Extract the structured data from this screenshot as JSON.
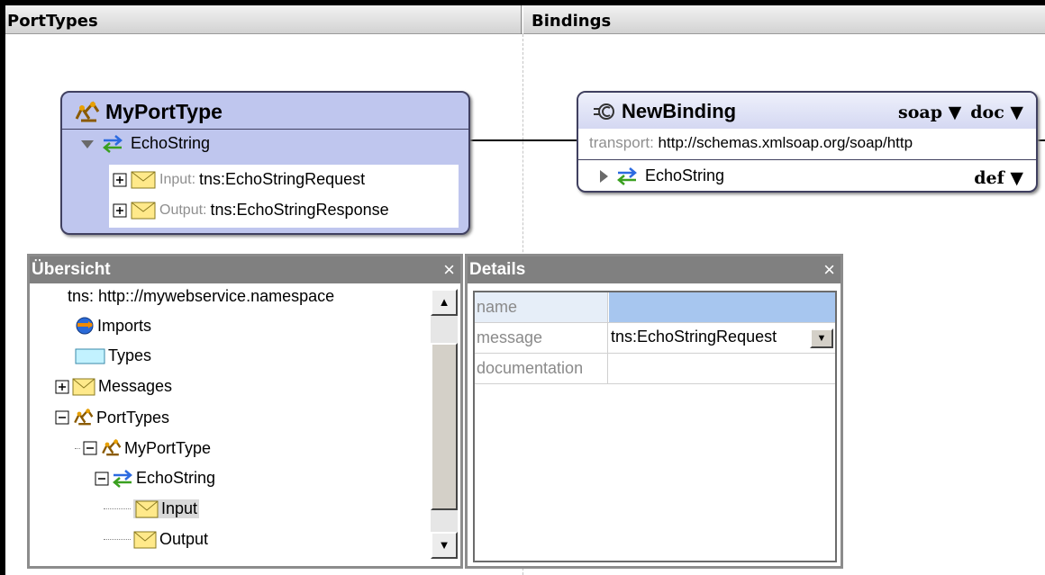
{
  "header": {
    "porttypes_title": "PortTypes",
    "bindings_title": "Bindings"
  },
  "porttype_box": {
    "title": "MyPortType",
    "operation": "EchoString",
    "input_label": "Input:",
    "input_value": "tns:EchoStringRequest",
    "output_label": "Output:",
    "output_value": "tns:EchoStringResponse",
    "background": "#bfc6ee"
  },
  "binding_box": {
    "title": "NewBinding",
    "protocol": "soap",
    "style": "doc",
    "transport_label": "transport:",
    "transport_value": "http://schemas.xmlsoap.org/soap/http",
    "operation": "EchoString",
    "operation_style": "def"
  },
  "overview": {
    "title": "Übersicht",
    "close": "×",
    "tree": {
      "namespace": "tns:  http:://mywebservice.namespace",
      "imports": "Imports",
      "types": "Types",
      "messages": "Messages",
      "porttypes": "PortTypes",
      "myporttype": "MyPortType",
      "echostring": "EchoString",
      "input": "Input",
      "output": "Output"
    }
  },
  "details": {
    "title": "Details",
    "close": "×",
    "rows": [
      {
        "key": "name",
        "value": ""
      },
      {
        "key": "message",
        "value": "tns:EchoStringRequest"
      },
      {
        "key": "documentation",
        "value": ""
      }
    ],
    "selected_color": "#a7c6ef"
  },
  "icons": {
    "porttype": "porttype-icon",
    "operation": "operation-arrows-icon",
    "message": "envelope-icon",
    "binding": "binding-icon",
    "imports": "imports-globe-icon",
    "types": "types-box-icon"
  }
}
